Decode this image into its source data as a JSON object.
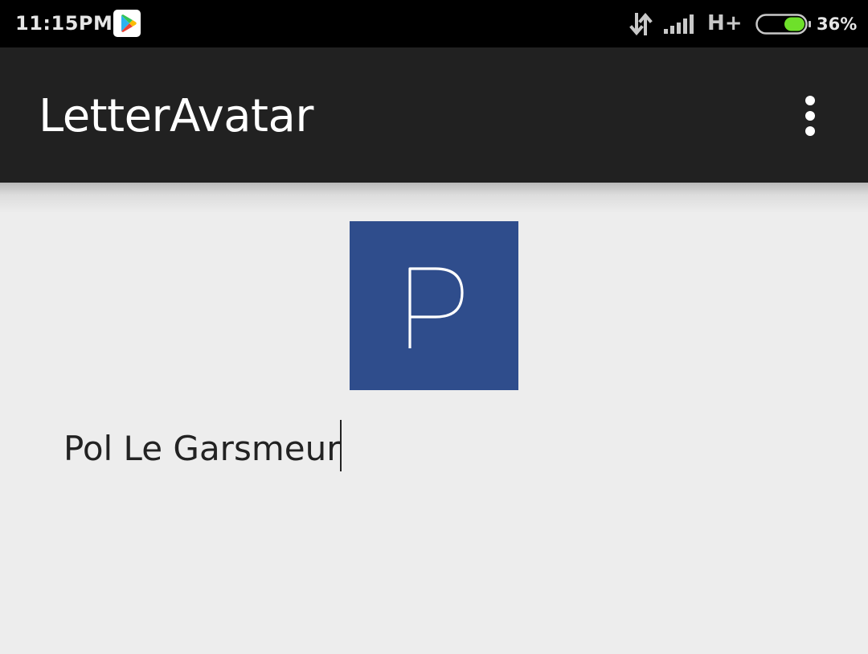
{
  "status_bar": {
    "time": "11:15PM",
    "notification_icon": "play-store-icon",
    "data_icon": "data-transfer-icon",
    "signal_icon": "signal-bars-icon",
    "network_type": "H+",
    "battery_icon": "battery-icon",
    "battery_level": 0.36,
    "battery_percent": "36%"
  },
  "action_bar": {
    "title": "LetterAvatar",
    "menu_icon": "overflow-menu-icon"
  },
  "avatar": {
    "letter": "P",
    "background_color": "#2f4d8c",
    "letter_color": "#ffffff"
  },
  "name_field": {
    "value": "Pol Le Garsmeur"
  },
  "colors": {
    "status_bar": "#000000",
    "action_bar": "#212121",
    "background": "#ededed",
    "battery_fill": "#6ee02a"
  }
}
